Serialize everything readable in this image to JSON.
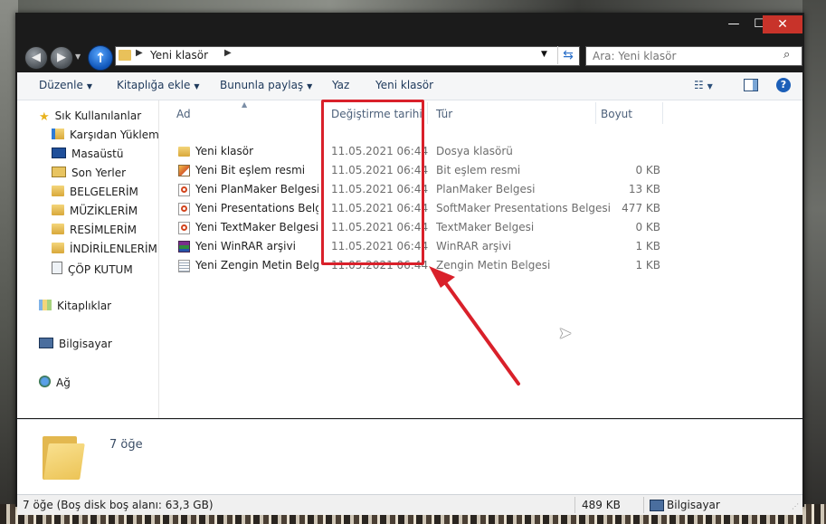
{
  "window": {
    "caption_buttons": {
      "minimize": "—",
      "maximize": "☐",
      "close": "✕"
    }
  },
  "navigation": {
    "back_icon": "arrow-left-icon",
    "forward_icon": "arrow-right-icon",
    "up_icon": "arrow-up-icon"
  },
  "address": {
    "path_label": "Yeni klasör",
    "separator": "▶"
  },
  "search": {
    "placeholder": "Ara: Yeni klasör",
    "icon": "search-icon"
  },
  "toolbar": {
    "organize": "Düzenle",
    "include_in_library": "Kitaplığa ekle",
    "share_with": "Bununla paylaş",
    "burn": "Yaz",
    "new_folder": "Yeni klasör"
  },
  "sidebar": {
    "favorites_header": "Sık Kullanılanlar",
    "favorites": [
      {
        "label": "Karşıdan Yüklemeler",
        "icon": "download-folder-icon"
      },
      {
        "label": "Masaüstü",
        "icon": "desktop-icon"
      },
      {
        "label": "Son Yerler",
        "icon": "recent-places-icon"
      },
      {
        "label": "BELGELERİM",
        "icon": "folder-icon"
      },
      {
        "label": "MÜZİKLERİM",
        "icon": "folder-icon"
      },
      {
        "label": "RESİMLERİM",
        "icon": "folder-icon"
      },
      {
        "label": "İNDİRİLENLERİM",
        "icon": "folder-icon"
      },
      {
        "label": "ÇÖP KUTUM",
        "icon": "recycle-bin-icon"
      }
    ],
    "libraries": "Kitaplıklar",
    "computer": "Bilgisayar",
    "network": "Ağ"
  },
  "file_list": {
    "columns": {
      "name": "Ad",
      "modified": "Değiştirme tarihi",
      "type": "Tür",
      "size": "Boyut"
    },
    "rows": [
      {
        "name": "Yeni klasör",
        "modified": "11.05.2021 06:44",
        "type": "Dosya klasörü",
        "size": "",
        "icon": "folder-icon"
      },
      {
        "name": "Yeni Bit eşlem resmi",
        "modified": "11.05.2021 06:44",
        "type": "Bit eşlem resmi",
        "size": "0 KB",
        "icon": "bitmap-icon"
      },
      {
        "name": "Yeni PlanMaker Belgesi",
        "modified": "11.05.2021 06:44",
        "type": "PlanMaker Belgesi",
        "size": "13 KB",
        "icon": "planmaker-icon"
      },
      {
        "name": "Yeni Presentations Belgesi",
        "modified": "11.05.2021 06:44",
        "type": "SoftMaker Presentations Belgesi",
        "size": "477 KB",
        "icon": "presentations-icon"
      },
      {
        "name": "Yeni TextMaker Belgesi",
        "modified": "11.05.2021 06:44",
        "type": "TextMaker Belgesi",
        "size": "0 KB",
        "icon": "textmaker-icon"
      },
      {
        "name": "Yeni WinRAR arşivi",
        "modified": "11.05.2021 06:44",
        "type": "WinRAR arşivi",
        "size": "1 KB",
        "icon": "winrar-icon"
      },
      {
        "name": "Yeni Zengin Metin Belgesi",
        "modified": "11.05.2021 06:44",
        "type": "Zengin Metin Belgesi",
        "size": "1 KB",
        "icon": "rich-text-icon"
      }
    ]
  },
  "details_pane": {
    "count": "7 öğe"
  },
  "status_bar": {
    "summary": "7 öğe (Boş disk boş alanı: 63,3 GB)",
    "size": "489 KB",
    "location": "Bilgisayar"
  },
  "annotation": {
    "highlight_color": "#d9202a"
  }
}
